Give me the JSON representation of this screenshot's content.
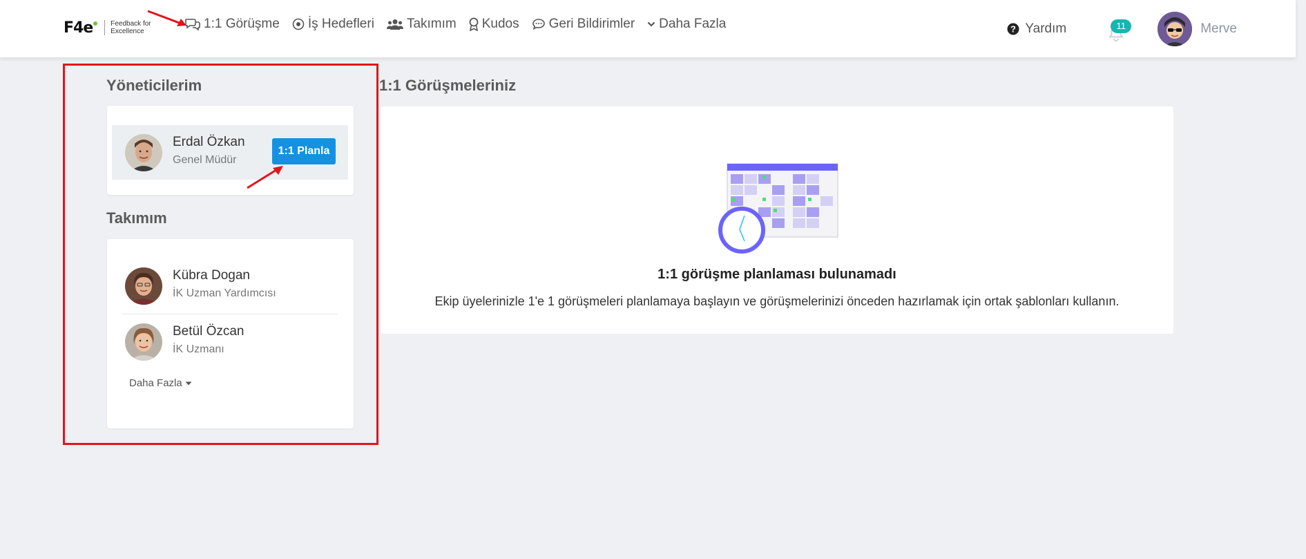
{
  "app": {
    "logo_mark": "F4e",
    "logo_tagline_1": "Feedback for",
    "logo_tagline_2": "Excellence"
  },
  "nav": {
    "items": [
      {
        "label": "1:1 Görüşme",
        "icon": "chat-icon"
      },
      {
        "label": "İş Hedefleri",
        "icon": "target-icon"
      },
      {
        "label": "Takımım",
        "icon": "users-icon"
      },
      {
        "label": "Kudos",
        "icon": "award-icon"
      },
      {
        "label": "Geri Bildirimler",
        "icon": "comment-icon"
      },
      {
        "label": "Daha Fazla",
        "icon": "chevron-down-icon"
      }
    ],
    "help_label": "Yardım",
    "notifications_count": "11",
    "user_name": "Merve"
  },
  "sidebar": {
    "managers_title": "Yöneticilerim",
    "managers": [
      {
        "name": "Erdal Özkan",
        "role": "Genel Müdür",
        "action_label": "1:1 Planla"
      }
    ],
    "team_title": "Takımım",
    "team": [
      {
        "name": "Kübra Dogan",
        "role": "İK Uzman Yardımcısı"
      },
      {
        "name": "Betül Özcan",
        "role": "İK Uzmanı"
      }
    ],
    "more_label": "Daha Fazla"
  },
  "main": {
    "title": "1:1 Görüşmeleriniz",
    "empty_title": "1:1 görüşme planlaması bulunamadı",
    "empty_description": "Ekip üyelerinizle 1'e 1 görüşmeleri planlamaya başlayın ve görüşmelerinizi önceden hazırlamak için ortak şablonları kullanın."
  },
  "colors": {
    "accent": "#1591e2",
    "badge": "#17b6b0",
    "annotation": "#e3141b",
    "illustration": "#6c63ff"
  }
}
